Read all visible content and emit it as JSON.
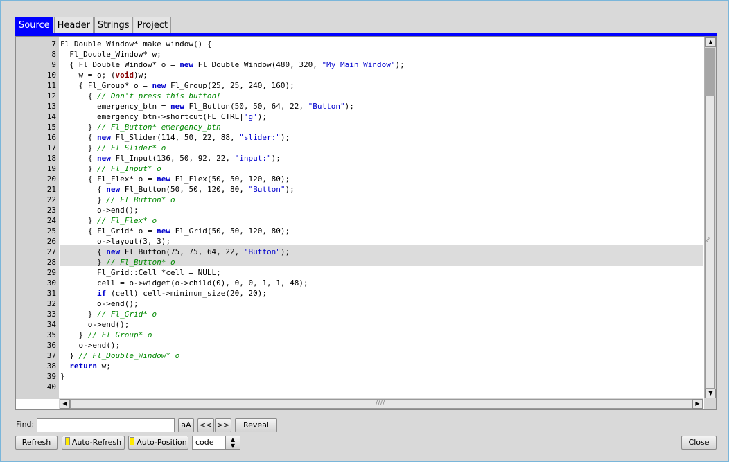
{
  "tabs": [
    {
      "label": "Source",
      "active": true
    },
    {
      "label": "Header",
      "active": false
    },
    {
      "label": "Strings",
      "active": false
    },
    {
      "label": "Project",
      "active": false
    }
  ],
  "code_lines": [
    {
      "num": "7",
      "html": "Fl_Double_Window* make_window() {"
    },
    {
      "num": "8",
      "html": "  Fl_Double_Window* w;"
    },
    {
      "num": "9",
      "html": "  { Fl_Double_Window* o = <span class='kw'>new</span> Fl_Double_Window(480, 320, <span class='str'>\"My Main Window\"</span>);"
    },
    {
      "num": "10",
      "html": "    w = o; (<span class='kr'>void</span>)w;"
    },
    {
      "num": "11",
      "html": "    { Fl_Group* o = <span class='kw'>new</span> Fl_Group(25, 25, 240, 160);"
    },
    {
      "num": "12",
      "html": "      { <span class='cm'>// Don't press this button!</span>"
    },
    {
      "num": "13",
      "html": "        emergency_btn = <span class='kw'>new</span> Fl_Button(50, 50, 64, 22, <span class='str'>\"Button\"</span>);"
    },
    {
      "num": "14",
      "html": "        emergency_btn-&gt;shortcut(FL_CTRL|<span class='str'>'g'</span>);"
    },
    {
      "num": "15",
      "html": "      } <span class='cm'>// Fl_Button* emergency_btn</span>"
    },
    {
      "num": "16",
      "html": "      { <span class='kw'>new</span> Fl_Slider(114, 50, 22, 88, <span class='str'>\"slider:\"</span>);"
    },
    {
      "num": "17",
      "html": "      } <span class='cm'>// Fl_Slider* o</span>"
    },
    {
      "num": "18",
      "html": "      { <span class='kw'>new</span> Fl_Input(136, 50, 92, 22, <span class='str'>\"input:\"</span>);"
    },
    {
      "num": "19",
      "html": "      } <span class='cm'>// Fl_Input* o</span>"
    },
    {
      "num": "20",
      "html": "      { Fl_Flex* o = <span class='kw'>new</span> Fl_Flex(50, 50, 120, 80);"
    },
    {
      "num": "21",
      "html": "        { <span class='kw'>new</span> Fl_Button(50, 50, 120, 80, <span class='str'>\"Button\"</span>);"
    },
    {
      "num": "22",
      "html": "        } <span class='cm'>// Fl_Button* o</span>"
    },
    {
      "num": "23",
      "html": "        o-&gt;end();"
    },
    {
      "num": "24",
      "html": "      } <span class='cm'>// Fl_Flex* o</span>"
    },
    {
      "num": "25",
      "html": "      { Fl_Grid* o = <span class='kw'>new</span> Fl_Grid(50, 50, 120, 80);"
    },
    {
      "num": "26",
      "html": "        o-&gt;layout(3, 3);"
    },
    {
      "num": "27",
      "html": "        { <span class='kw'>new</span> Fl_Button(75, 75, 64, 22, <span class='str'>\"Button\"</span>);"
    },
    {
      "num": "28",
      "html": "        } <span class='cm'>// Fl_Button* o</span>"
    },
    {
      "num": "29",
      "html": "        Fl_Grid::Cell *cell = NULL;"
    },
    {
      "num": "30",
      "html": "        cell = o-&gt;widget(o-&gt;child(0), 0, 0, 1, 1, 48);"
    },
    {
      "num": "31",
      "html": "        <span class='kw'>if</span> (cell) cell-&gt;minimum_size(20, 20);"
    },
    {
      "num": "32",
      "html": "        o-&gt;end();"
    },
    {
      "num": "33",
      "html": "      } <span class='cm'>// Fl_Grid* o</span>"
    },
    {
      "num": "34",
      "html": "      o-&gt;end();"
    },
    {
      "num": "35",
      "html": "    } <span class='cm'>// Fl_Group* o</span>"
    },
    {
      "num": "36",
      "html": "    o-&gt;end();"
    },
    {
      "num": "37",
      "html": "  } <span class='cm'>// Fl_Double_Window* o</span>"
    },
    {
      "num": "38",
      "html": "  <span class='kw'>return</span> w;"
    },
    {
      "num": "39",
      "html": "}"
    },
    {
      "num": "40",
      "html": ""
    }
  ],
  "find": {
    "label": "Find:",
    "value": "",
    "case_label": "aA",
    "prev_label": "<<",
    "next_label": ">>",
    "reveal_label": "Reveal"
  },
  "bottom": {
    "refresh_label": "Refresh",
    "auto_refresh_label": "Auto-Refresh",
    "auto_position_label": "Auto-Position",
    "mode_value": "code",
    "close_label": "Close"
  },
  "colors": {
    "accent": "#0000ff",
    "keyword": "#0000cc",
    "comment": "#008800",
    "string": "#0000cc",
    "type_keyword": "#880000",
    "toggle_led": "#ffea00"
  }
}
